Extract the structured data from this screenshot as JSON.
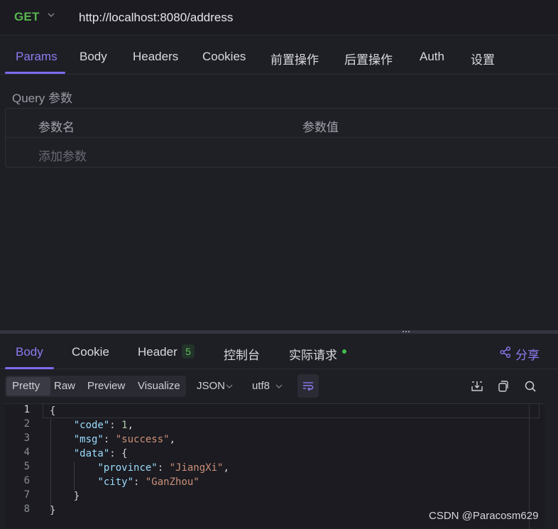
{
  "request": {
    "method": "GET",
    "url": "http://localhost:8080/address"
  },
  "request_tabs": [
    "Params",
    "Body",
    "Headers",
    "Cookies",
    "前置操作",
    "后置操作",
    "Auth",
    "设置"
  ],
  "params": {
    "section_label": "Query 参数",
    "col_name": "参数名",
    "col_value": "参数值",
    "add_placeholder": "添加参数"
  },
  "response_tabs": {
    "body": "Body",
    "cookie": "Cookie",
    "header": "Header",
    "header_count": "5",
    "console": "控制台",
    "actual_request": "实际请求",
    "share": "分享"
  },
  "view_modes": [
    "Pretty",
    "Raw",
    "Preview",
    "Visualize"
  ],
  "format": "JSON",
  "encoding": "utf8",
  "code_lines": [
    {
      "n": "1",
      "parts": [
        [
          "pun",
          "{"
        ]
      ]
    },
    {
      "n": "2",
      "parts": [
        [
          "pun",
          "    "
        ],
        [
          "key",
          "\"code\""
        ],
        [
          "pun",
          ": "
        ],
        [
          "num",
          "1"
        ],
        [
          "pun",
          ","
        ]
      ]
    },
    {
      "n": "3",
      "parts": [
        [
          "pun",
          "    "
        ],
        [
          "key",
          "\"msg\""
        ],
        [
          "pun",
          ": "
        ],
        [
          "str",
          "\"success\""
        ],
        [
          "pun",
          ","
        ]
      ]
    },
    {
      "n": "4",
      "parts": [
        [
          "pun",
          "    "
        ],
        [
          "key",
          "\"data\""
        ],
        [
          "pun",
          ": {"
        ]
      ]
    },
    {
      "n": "5",
      "parts": [
        [
          "pun",
          "        "
        ],
        [
          "key",
          "\"province\""
        ],
        [
          "pun",
          ": "
        ],
        [
          "str",
          "\"JiangXi\""
        ],
        [
          "pun",
          ","
        ]
      ]
    },
    {
      "n": "6",
      "parts": [
        [
          "pun",
          "        "
        ],
        [
          "key",
          "\"city\""
        ],
        [
          "pun",
          ": "
        ],
        [
          "str",
          "\"GanZhou\""
        ]
      ]
    },
    {
      "n": "7",
      "parts": [
        [
          "pun",
          "    }"
        ]
      ]
    },
    {
      "n": "8",
      "parts": [
        [
          "pun",
          "}"
        ]
      ]
    }
  ],
  "watermark": "CSDN @Paracosm629",
  "colors": {
    "accent": "#7c6cf0",
    "method_get": "#59b44f",
    "background": "#1e1e25"
  }
}
